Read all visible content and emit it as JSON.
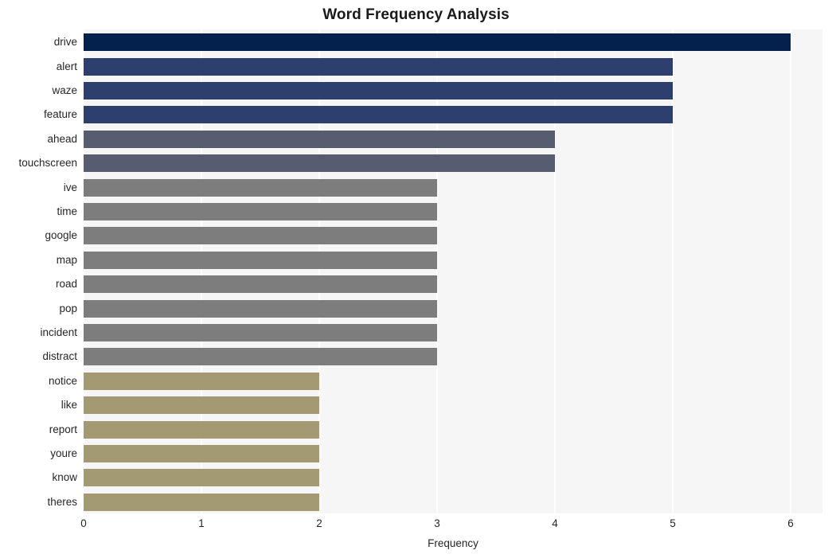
{
  "chart_data": {
    "type": "bar",
    "orientation": "horizontal",
    "title": "Word Frequency Analysis",
    "xlabel": "Frequency",
    "ylabel": "",
    "xlim": [
      0,
      6.27
    ],
    "xticks": [
      0,
      1,
      2,
      3,
      4,
      5,
      6
    ],
    "xtick_labels": [
      "0",
      "1",
      "2",
      "3",
      "4",
      "5",
      "6"
    ],
    "grid": "vertical-white-on-light-gray",
    "legend": "none",
    "categories": [
      "drive",
      "alert",
      "waze",
      "feature",
      "ahead",
      "touchscreen",
      "ive",
      "time",
      "google",
      "map",
      "road",
      "pop",
      "incident",
      "distract",
      "notice",
      "like",
      "report",
      "youre",
      "know",
      "theres"
    ],
    "values": [
      6,
      5,
      5,
      5,
      4,
      4,
      3,
      3,
      3,
      3,
      3,
      3,
      3,
      3,
      2,
      2,
      2,
      2,
      2,
      2
    ],
    "bar_colors": [
      "#03214c",
      "#2c3f6d",
      "#2c3f6d",
      "#2c3f6d",
      "#575c70",
      "#575c70",
      "#7d7d7d",
      "#7d7d7d",
      "#7d7d7d",
      "#7d7d7d",
      "#7d7d7d",
      "#7d7d7d",
      "#7d7d7d",
      "#7d7d7d",
      "#a39a73",
      "#a39a73",
      "#a39a73",
      "#a39a73",
      "#a39a73",
      "#a39a73"
    ],
    "bars": [
      {
        "label": "drive",
        "value": 6,
        "color": "#03214c"
      },
      {
        "label": "alert",
        "value": 5,
        "color": "#2c3f6d"
      },
      {
        "label": "waze",
        "value": 5,
        "color": "#2c3f6d"
      },
      {
        "label": "feature",
        "value": 5,
        "color": "#2c3f6d"
      },
      {
        "label": "ahead",
        "value": 4,
        "color": "#575c70"
      },
      {
        "label": "touchscreen",
        "value": 4,
        "color": "#575c70"
      },
      {
        "label": "ive",
        "value": 3,
        "color": "#7d7d7d"
      },
      {
        "label": "time",
        "value": 3,
        "color": "#7d7d7d"
      },
      {
        "label": "google",
        "value": 3,
        "color": "#7d7d7d"
      },
      {
        "label": "map",
        "value": 3,
        "color": "#7d7d7d"
      },
      {
        "label": "road",
        "value": 3,
        "color": "#7d7d7d"
      },
      {
        "label": "pop",
        "value": 3,
        "color": "#7d7d7d"
      },
      {
        "label": "incident",
        "value": 3,
        "color": "#7d7d7d"
      },
      {
        "label": "distract",
        "value": 3,
        "color": "#7d7d7d"
      },
      {
        "label": "notice",
        "value": 2,
        "color": "#a39a73"
      },
      {
        "label": "like",
        "value": 2,
        "color": "#a39a73"
      },
      {
        "label": "report",
        "value": 2,
        "color": "#a39a73"
      },
      {
        "label": "youre",
        "value": 2,
        "color": "#a39a73"
      },
      {
        "label": "know",
        "value": 2,
        "color": "#a39a73"
      },
      {
        "label": "theres",
        "value": 2,
        "color": "#a39a73"
      }
    ],
    "style": {
      "plot_background": "#f6f6f7",
      "figure_background": "#ffffff",
      "gridline_color": "#ffffff",
      "text_color": "#262626",
      "title_color": "#1a1a1a"
    }
  }
}
